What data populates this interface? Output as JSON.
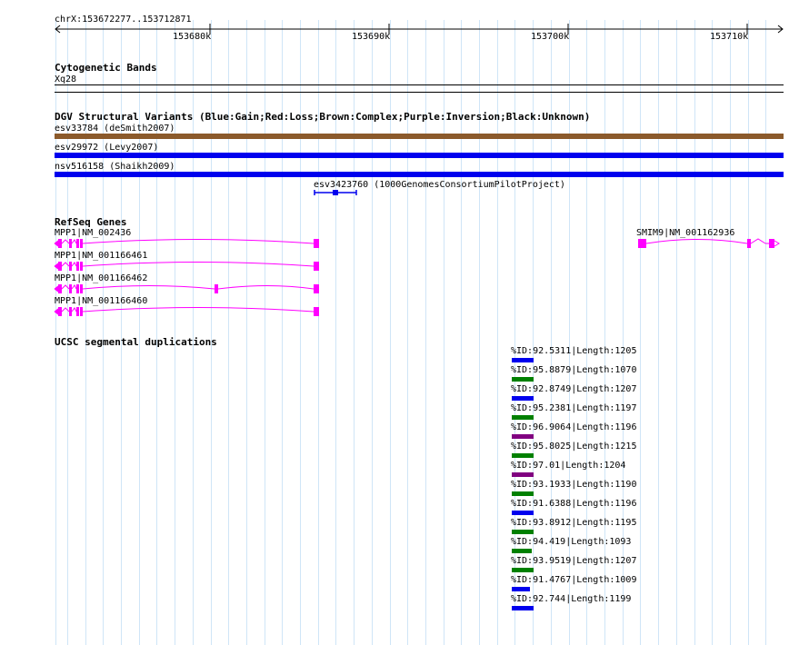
{
  "ruler": {
    "location": "chrX:153672277..153712871",
    "ticks": [
      "153680k",
      "153690k",
      "153700k",
      "153710k"
    ]
  },
  "cytoband": {
    "title": "Cytogenetic Bands",
    "band": "Xq28"
  },
  "dgv": {
    "title": "DGV Structural Variants (Blue:Gain;Red:Loss;Brown:Complex;Purple:Inversion;Black:Unknown)",
    "items": [
      {
        "label": "esv33784 (deSmith2007)",
        "color": "#8b5a2b"
      },
      {
        "label": "esv29972 (Levy2007)",
        "color": "#0000ee"
      },
      {
        "label": "nsv516158 (Shaikh2009)",
        "color": "#0000ee"
      },
      {
        "label": "esv3423760 (1000GenomesConsortiumPilotProject)",
        "color": "#0000ee"
      }
    ]
  },
  "refseq": {
    "title": "RefSeq Genes",
    "genes": [
      {
        "label": "MPP1|NM_002436"
      },
      {
        "label": "MPP1|NM_001166461"
      },
      {
        "label": "MPP1|NM_001166462"
      },
      {
        "label": "MPP1|NM_001166460"
      },
      {
        "label": "SMIM9|NM_001162936"
      }
    ],
    "color": "#ff00ff"
  },
  "segdups": {
    "title": "UCSC segmental duplications",
    "items": [
      {
        "label": "%ID:92.5311|Length:1205",
        "color": "#0000ee"
      },
      {
        "label": "%ID:95.8879|Length:1070",
        "color": "#008000"
      },
      {
        "label": "%ID:92.8749|Length:1207",
        "color": "#0000ee"
      },
      {
        "label": "%ID:95.2381|Length:1197",
        "color": "#008000"
      },
      {
        "label": "%ID:96.9064|Length:1196",
        "color": "#800080"
      },
      {
        "label": "%ID:95.8025|Length:1215",
        "color": "#008000"
      },
      {
        "label": "%ID:97.01|Length:1204",
        "color": "#800080"
      },
      {
        "label": "%ID:93.1933|Length:1190",
        "color": "#008000"
      },
      {
        "label": "%ID:91.6388|Length:1196",
        "color": "#0000ee"
      },
      {
        "label": "%ID:93.8912|Length:1195",
        "color": "#008000"
      },
      {
        "label": "%ID:94.419|Length:1093",
        "color": "#008000"
      },
      {
        "label": "%ID:93.9519|Length:1207",
        "color": "#008000"
      },
      {
        "label": "%ID:91.4767|Length:1009",
        "color": "#0000ee"
      },
      {
        "label": "%ID:92.744|Length:1199",
        "color": "#0000ee"
      }
    ]
  }
}
